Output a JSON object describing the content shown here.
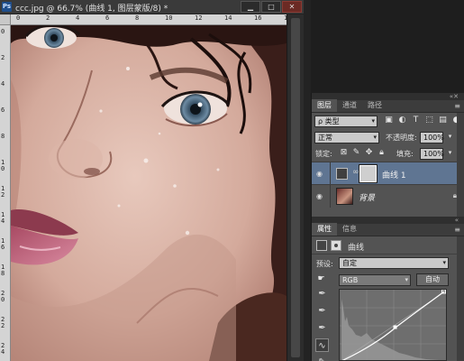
{
  "document": {
    "title": "ccc.jpg @ 66.7% (曲线 1, 图层蒙版/8) *",
    "app_icon": "Ps",
    "window_buttons": [
      "▁",
      "□",
      "✕"
    ],
    "ruler_top": [
      "0",
      "2",
      "4",
      "6",
      "8",
      "10",
      "12",
      "14",
      "16",
      "18"
    ],
    "ruler_left": [
      "0",
      "2",
      "4",
      "6",
      "8",
      "10",
      "12",
      "14",
      "16",
      "18",
      "20",
      "22",
      "24"
    ]
  },
  "layers_panel": {
    "tabs": [
      "图层",
      "通道",
      "路径"
    ],
    "filter": {
      "label": "ρ 类型",
      "icons": [
        "image-filter-icon",
        "adjustment-filter-icon",
        "type-filter-icon",
        "shape-filter-icon",
        "smart-object-filter-icon"
      ]
    },
    "blend_mode": "正常",
    "opacity_label": "不透明度:",
    "opacity_value": "100%",
    "lock_label": "锁定:",
    "fill_label": "填充:",
    "fill_value": "100%",
    "layers": [
      {
        "name": "曲线 1",
        "type": "curves-adjustment",
        "visible": true,
        "selected": true
      },
      {
        "name": "背景",
        "type": "background",
        "visible": true,
        "locked": true
      }
    ]
  },
  "properties_panel": {
    "tabs": [
      "属性",
      "信息"
    ],
    "adjustment_name": "曲线",
    "preset_label": "预设:",
    "preset_value": "自定",
    "channel_value": "RGB",
    "auto_label": "自动"
  },
  "colors": {
    "app_bg": "#1e1e1e",
    "panel_bg": "#535353",
    "selected_layer": "#5f7592"
  }
}
